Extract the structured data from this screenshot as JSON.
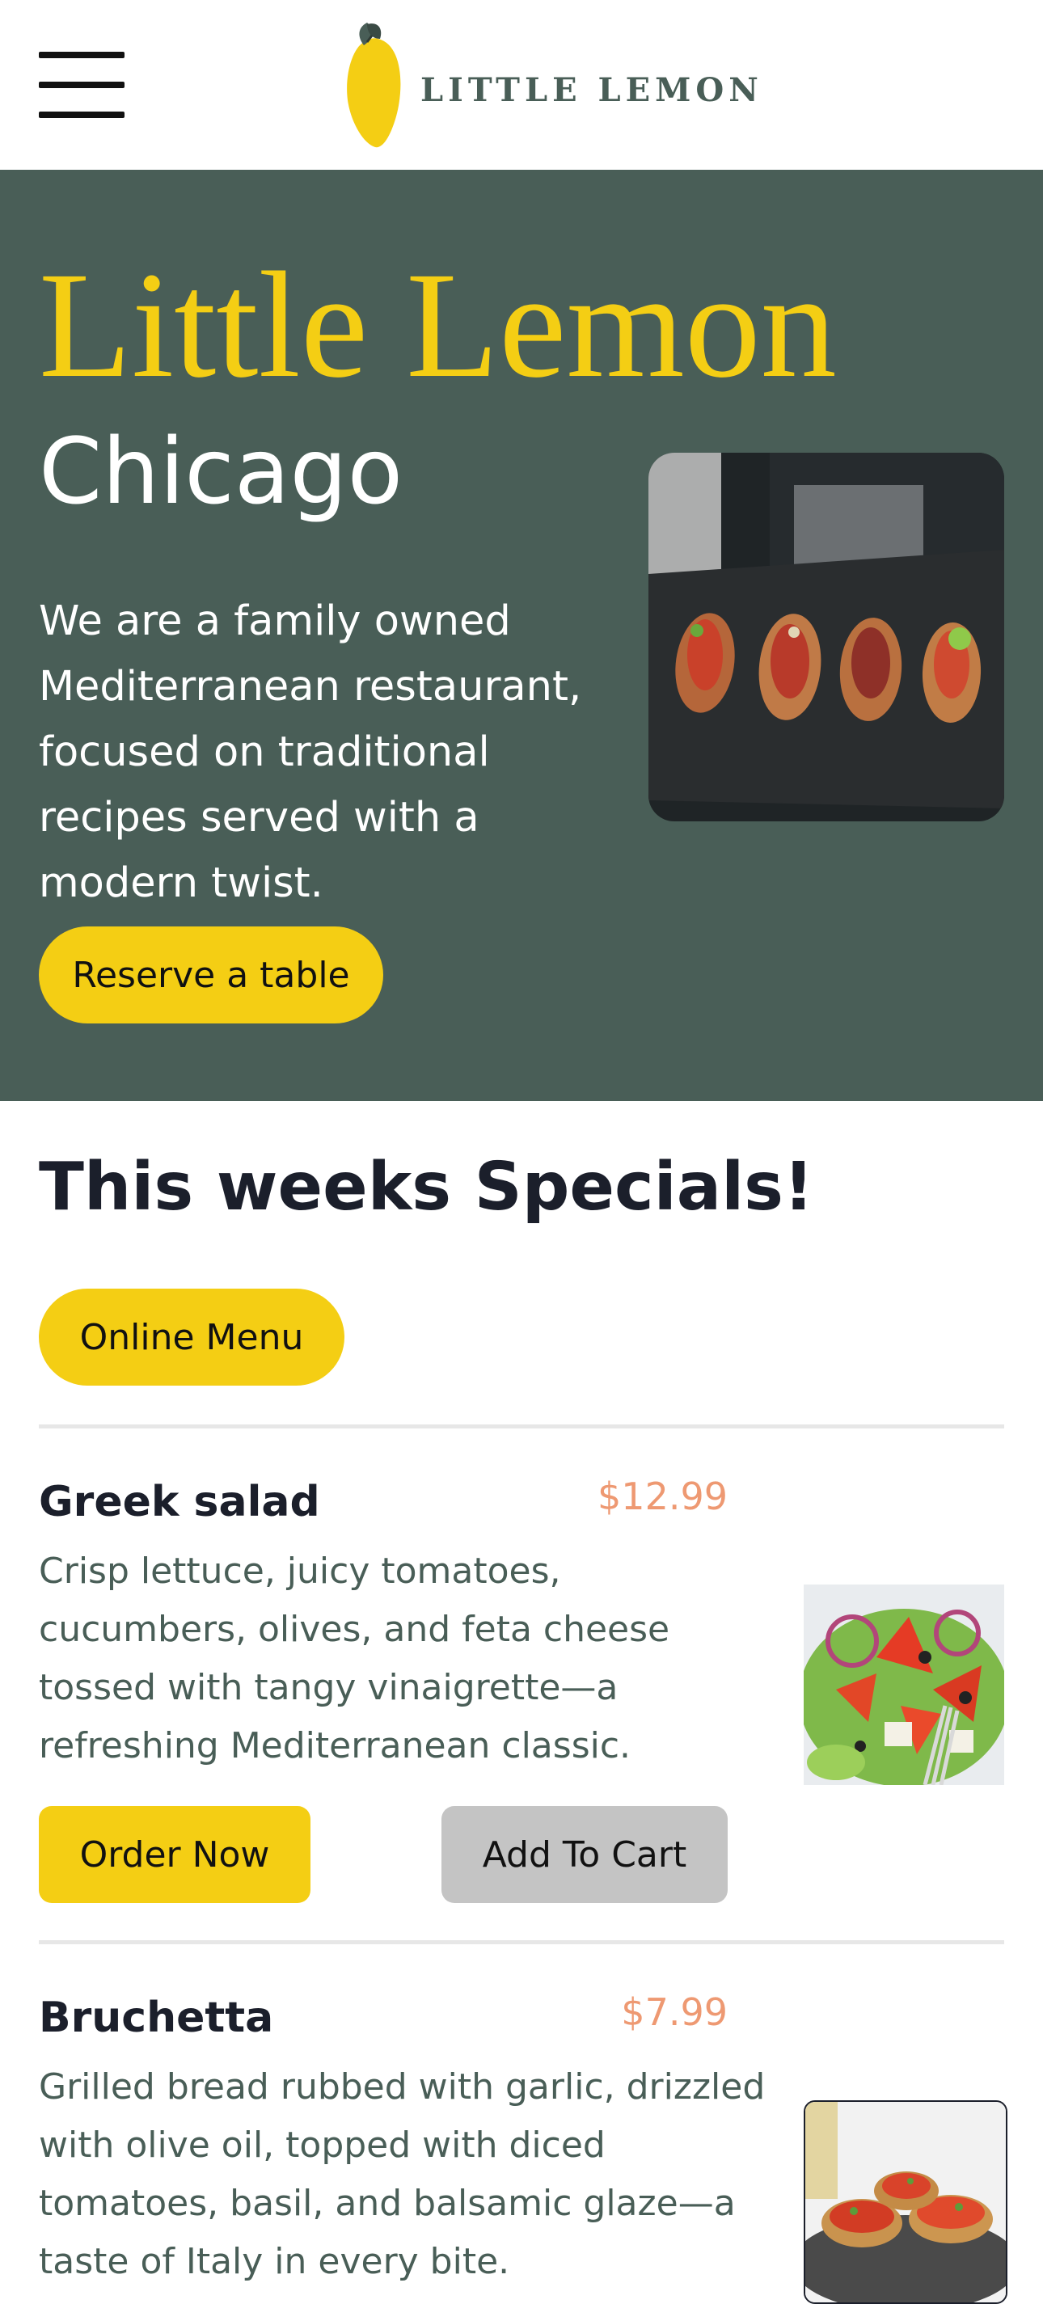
{
  "brand": {
    "logo_text": "LITTLE LEMON"
  },
  "colors": {
    "primary_green": "#495e57",
    "primary_yellow": "#f4ce14",
    "price_orange": "#ee9972",
    "cart_gray": "#c4c4c4"
  },
  "hero": {
    "title": "Little Lemon",
    "subtitle": "Chicago",
    "description": "We are a family owned Mediterranean restaurant, focused on traditional recipes served with a modern twist.",
    "cta_label": "Reserve a table",
    "image_icon": "plated-bruschetta-photo"
  },
  "specials": {
    "title": "This weeks Specials!",
    "menu_button_label": "Online Menu",
    "items": [
      {
        "name": "Greek salad",
        "price": "$12.99",
        "description": "Crisp lettuce, juicy tomatoes, cucumbers, olives, and feta cheese tossed with tangy vinaigrette—a refreshing Mediterranean classic.",
        "order_label": "Order Now",
        "cart_label": "Add To Cart",
        "image_icon": "greek-salad-photo"
      },
      {
        "name": "Bruchetta",
        "price": "$7.99",
        "description": "Grilled bread rubbed with garlic, drizzled with olive oil, topped with diced tomatoes, basil, and balsamic glaze—a taste of Italy in every bite.",
        "image_icon": "bruschetta-photo"
      }
    ]
  }
}
